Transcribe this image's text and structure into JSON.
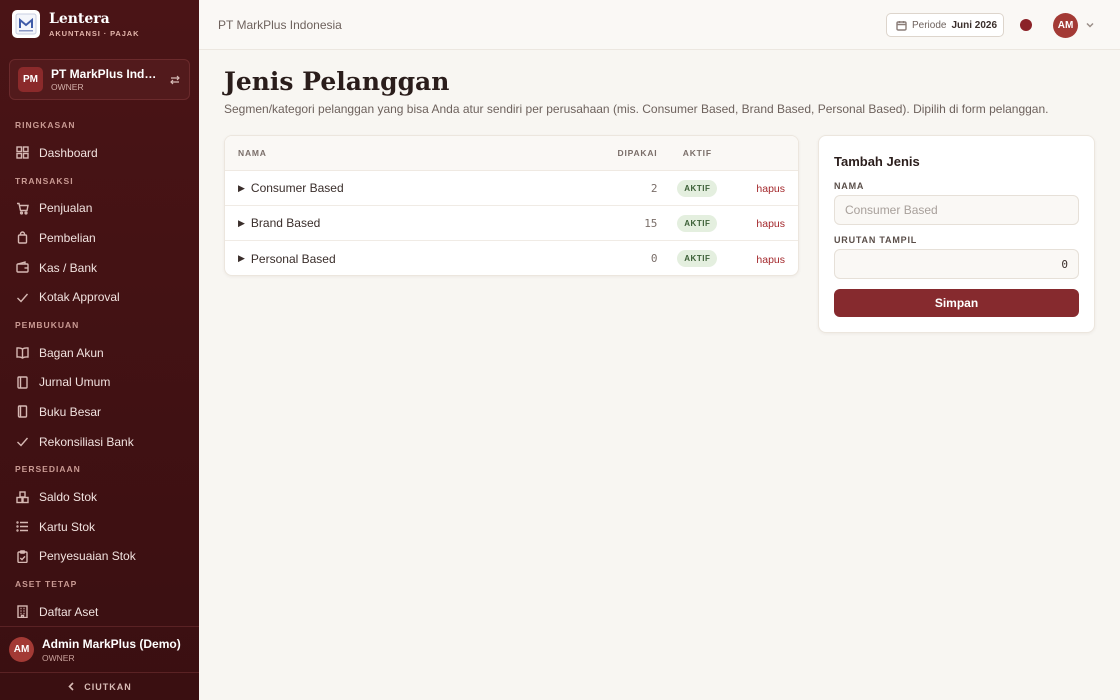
{
  "brand": {
    "name": "Lentera",
    "tagline": "AKUNTANSI · PAJAK"
  },
  "company": {
    "initials": "PM",
    "name": "PT MarkPlus Indonesia",
    "role": "OWNER"
  },
  "nav": [
    {
      "section": "RINGKASAN",
      "items": [
        {
          "label": "Dashboard",
          "icon": "grid-icon"
        }
      ]
    },
    {
      "section": "TRANSAKSI",
      "items": [
        {
          "label": "Penjualan",
          "icon": "cart-icon"
        },
        {
          "label": "Pembelian",
          "icon": "bag-icon"
        },
        {
          "label": "Kas / Bank",
          "icon": "wallet-icon"
        },
        {
          "label": "Kotak Approval",
          "icon": "check-icon"
        }
      ]
    },
    {
      "section": "PEMBUKUAN",
      "items": [
        {
          "label": "Bagan Akun",
          "icon": "book-icon"
        },
        {
          "label": "Jurnal Umum",
          "icon": "journal-icon"
        },
        {
          "label": "Buku Besar",
          "icon": "ledger-icon"
        },
        {
          "label": "Rekonsiliasi Bank",
          "icon": "check-icon"
        }
      ]
    },
    {
      "section": "PERSEDIAAN",
      "items": [
        {
          "label": "Saldo Stok",
          "icon": "boxes-icon"
        },
        {
          "label": "Kartu Stok",
          "icon": "list-icon"
        },
        {
          "label": "Penyesuaian Stok",
          "icon": "clipboard-icon"
        }
      ]
    },
    {
      "section": "ASET TETAP",
      "items": [
        {
          "label": "Daftar Aset",
          "icon": "building-icon"
        }
      ]
    }
  ],
  "user": {
    "initials": "AM",
    "name": "Admin MarkPlus (Demo)",
    "role": "OWNER"
  },
  "collapse_label": "CIUTKAN",
  "topbar": {
    "breadcrumb": "PT MarkPlus Indonesia",
    "period_label": "Periode",
    "period_value": "Juni 2026",
    "avatar_initials": "AM",
    "status_color": "#8b2228"
  },
  "page": {
    "title": "Jenis Pelanggan",
    "description": "Segmen/kategori pelanggan yang bisa Anda atur sendiri per perusahaan (mis. Consumer Based, Brand Based, Personal Based). Dipilih di form pelanggan."
  },
  "table": {
    "headers": {
      "name": "NAMA",
      "used": "DIPAKAI",
      "active": "AKTIF"
    },
    "rows": [
      {
        "name": "Consumer Based",
        "used": "2",
        "status": "AKTIF",
        "action": "hapus"
      },
      {
        "name": "Brand Based",
        "used": "15",
        "status": "AKTIF",
        "action": "hapus"
      },
      {
        "name": "Personal Based",
        "used": "0",
        "status": "AKTIF",
        "action": "hapus"
      }
    ]
  },
  "form": {
    "title": "Tambah Jenis",
    "name_label": "NAMA",
    "name_placeholder": "Consumer Based",
    "order_label": "URUTAN TAMPIL",
    "order_value": "0",
    "submit_label": "Simpan"
  },
  "colors": {
    "sidebar": "#4a1416",
    "accent": "#862a2e",
    "badge_bg": "#e4efdf",
    "badge_text": "#3b5f36",
    "danger": "#a4282c"
  }
}
